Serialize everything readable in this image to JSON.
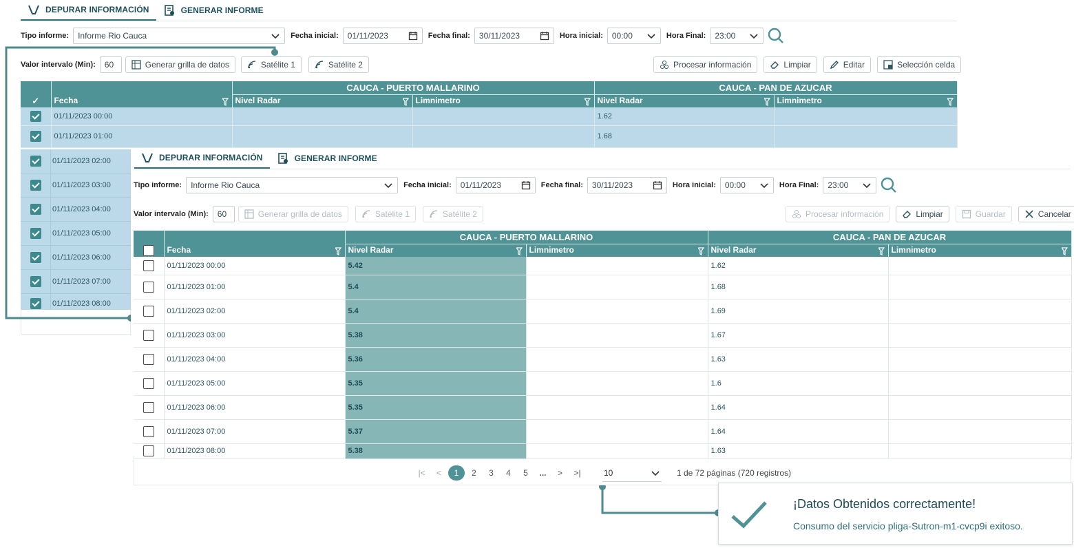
{
  "colors": {
    "accent": "#4f9396",
    "selected_row": "#bcd9ea",
    "radar_col": "#86b6b5",
    "connector": "#4f8a8c"
  },
  "back": {
    "tabs": [
      {
        "label": "DEPURAR INFORMACIÓN",
        "icon": "funnel-icon"
      },
      {
        "label": "GENERAR INFORME",
        "icon": "report-icon"
      }
    ],
    "form": {
      "tipo_label": "Tipo informe:",
      "tipo_value": "Informe Rio Cauca",
      "fecha_ini_label": "Fecha inicial:",
      "fecha_ini_value": "01/11/2023",
      "fecha_fin_label": "Fecha final:",
      "fecha_fin_value": "30/11/2023",
      "hora_ini_label": "Hora inicial:",
      "hora_ini_value": "00:00",
      "hora_fin_label": "Hora Final:",
      "hora_fin_value": "23:00"
    },
    "toolbar": {
      "intervalo_label": "Valor intervalo (Min):",
      "intervalo_value": "60",
      "generar": "Generar grilla de datos",
      "sat1": "Satélite 1",
      "sat2": "Satélite 2",
      "procesar": "Procesar información",
      "limpiar": "Limpiar",
      "editar": "Editar",
      "seleccion": "Selección celda"
    },
    "grid": {
      "group1": "CAUCA - PUERTO MALLARINO",
      "group2": "CAUCA - PAN DE AZUCAR",
      "col_fecha": "Fecha",
      "col_radar": "Nivel Radar",
      "col_limni": "Limnimetro",
      "rows": [
        {
          "fecha": "01/11/2023 00:00",
          "r1": "",
          "l1": "",
          "r2": "1.62",
          "l2": ""
        },
        {
          "fecha": "01/11/2023 01:00",
          "r1": "",
          "l1": "",
          "r2": "1.68",
          "l2": ""
        }
      ],
      "peek_rows": [
        "01/11/2023 02:00",
        "01/11/2023 03:00",
        "01/11/2023 04:00",
        "01/11/2023 05:00",
        "01/11/2023 06:00",
        "01/11/2023 07:00",
        "01/11/2023 08:00"
      ]
    }
  },
  "front": {
    "tabs": [
      {
        "label": "DEPURAR INFORMACIÓN",
        "icon": "funnel-icon"
      },
      {
        "label": "GENERAR INFORME",
        "icon": "report-icon"
      }
    ],
    "form": {
      "tipo_label": "Tipo informe:",
      "tipo_value": "Informe Rio Cauca",
      "fecha_ini_label": "Fecha inicial:",
      "fecha_ini_value": "01/11/2023",
      "fecha_fin_label": "Fecha final:",
      "fecha_fin_value": "30/11/2023",
      "hora_ini_label": "Hora inicial:",
      "hora_ini_value": "00:00",
      "hora_fin_label": "Hora Final:",
      "hora_fin_value": "23:00"
    },
    "toolbar": {
      "intervalo_label": "Valor intervalo (Min):",
      "intervalo_value": "60",
      "generar": "Generar grilla de datos",
      "sat1": "Satélite 1",
      "sat2": "Satélite 2",
      "procesar": "Procesar información",
      "limpiar": "Limpiar",
      "guardar": "Guardar",
      "cancelar": "Cancelar"
    },
    "grid": {
      "group1": "CAUCA - PUERTO MALLARINO",
      "group2": "CAUCA - PAN DE AZUCAR",
      "col_fecha": "Fecha",
      "col_radar": "Nivel Radar",
      "col_limni": "Limnimetro",
      "rows": [
        {
          "fecha": "01/11/2023 00:00",
          "r1": "5.42",
          "l1": "",
          "r2": "1.62",
          "l2": ""
        },
        {
          "fecha": "01/11/2023 01:00",
          "r1": "5.4",
          "l1": "",
          "r2": "1.68",
          "l2": ""
        },
        {
          "fecha": "01/11/2023 02:00",
          "r1": "5.4",
          "l1": "",
          "r2": "1.69",
          "l2": ""
        },
        {
          "fecha": "01/11/2023 03:00",
          "r1": "5.38",
          "l1": "",
          "r2": "1.67",
          "l2": ""
        },
        {
          "fecha": "01/11/2023 04:00",
          "r1": "5.36",
          "l1": "",
          "r2": "1.63",
          "l2": ""
        },
        {
          "fecha": "01/11/2023 05:00",
          "r1": "5.35",
          "l1": "",
          "r2": "1.6",
          "l2": ""
        },
        {
          "fecha": "01/11/2023 06:00",
          "r1": "5.35",
          "l1": "",
          "r2": "1.64",
          "l2": ""
        },
        {
          "fecha": "01/11/2023 07:00",
          "r1": "5.37",
          "l1": "",
          "r2": "1.64",
          "l2": ""
        },
        {
          "fecha": "01/11/2023 08:00",
          "r1": "5.38",
          "l1": "",
          "r2": "1.63",
          "l2": ""
        }
      ]
    },
    "pager": {
      "first": "|<",
      "prev": "<",
      "pages": [
        "1",
        "2",
        "3",
        "4",
        "5"
      ],
      "ellipsis": "...",
      "next": ">",
      "last": ">|",
      "current": "1",
      "page_size": "10",
      "info": "1 de 72 páginas (720 registros)"
    }
  },
  "toast": {
    "title": "¡Datos Obtenidos correctamente!",
    "message": "Consumo del servicio pliga-Sutron-m1-cvcp9i exitoso.",
    "icon": "check-icon"
  }
}
